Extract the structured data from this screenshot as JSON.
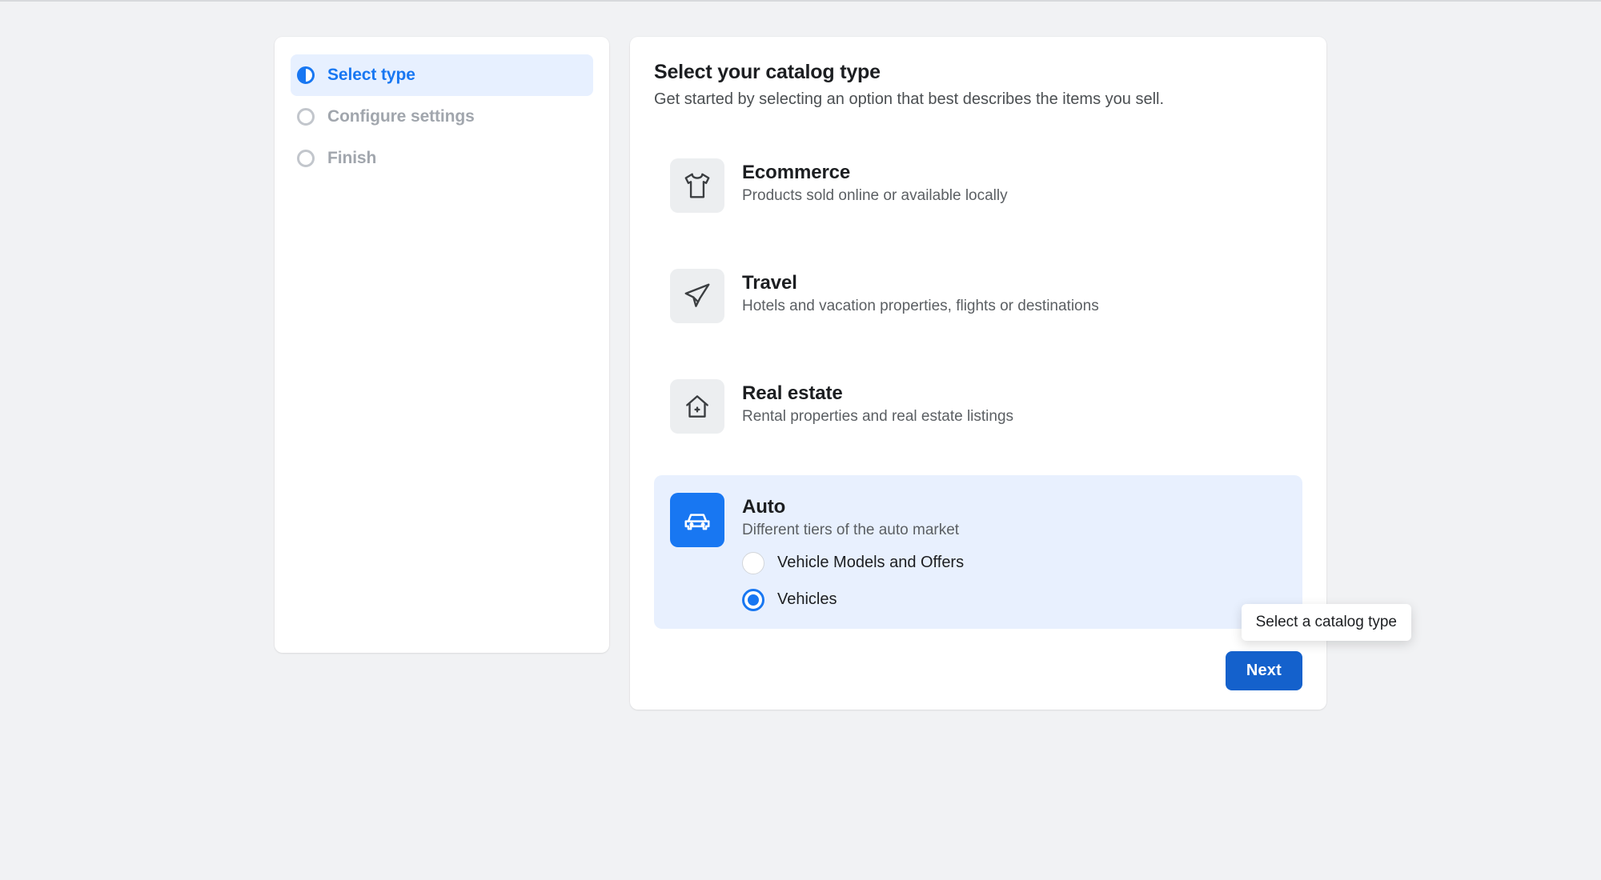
{
  "sidebar": {
    "steps": [
      {
        "label": "Select type"
      },
      {
        "label": "Configure settings"
      },
      {
        "label": "Finish"
      }
    ]
  },
  "main": {
    "title": "Select your catalog type",
    "subtitle": "Get started by selecting an option that best describes the items you sell.",
    "options": [
      {
        "id": "ecommerce",
        "title": "Ecommerce",
        "desc": "Products sold online or available locally"
      },
      {
        "id": "travel",
        "title": "Travel",
        "desc": "Hotels and vacation properties, flights or destinations"
      },
      {
        "id": "real-estate",
        "title": "Real estate",
        "desc": "Rental properties and real estate listings"
      },
      {
        "id": "auto",
        "title": "Auto",
        "desc": "Different tiers of the auto market",
        "radios": [
          {
            "label": "Vehicle Models and Offers"
          },
          {
            "label": "Vehicles"
          }
        ]
      }
    ],
    "selected_option": "auto",
    "selected_radio": 1,
    "next_button": "Next",
    "tooltip": "Select a catalog type"
  }
}
